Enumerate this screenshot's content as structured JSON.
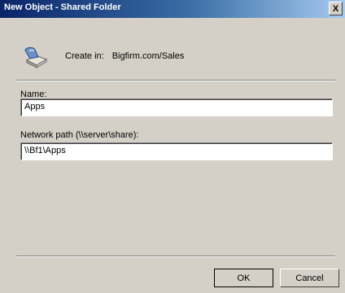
{
  "window": {
    "title": "New Object - Shared Folder",
    "close_label": "X"
  },
  "header": {
    "icon": "shared-folder-icon",
    "create_in_label": "Create in:",
    "create_in_value": "Bigfirm.com/Sales"
  },
  "form": {
    "name_label": "Name:",
    "name_value": "Apps",
    "path_label": "Network path (\\\\server\\share):",
    "path_value": "\\\\Bf1\\Apps"
  },
  "buttons": {
    "ok_label": "OK",
    "cancel_label": "Cancel"
  }
}
